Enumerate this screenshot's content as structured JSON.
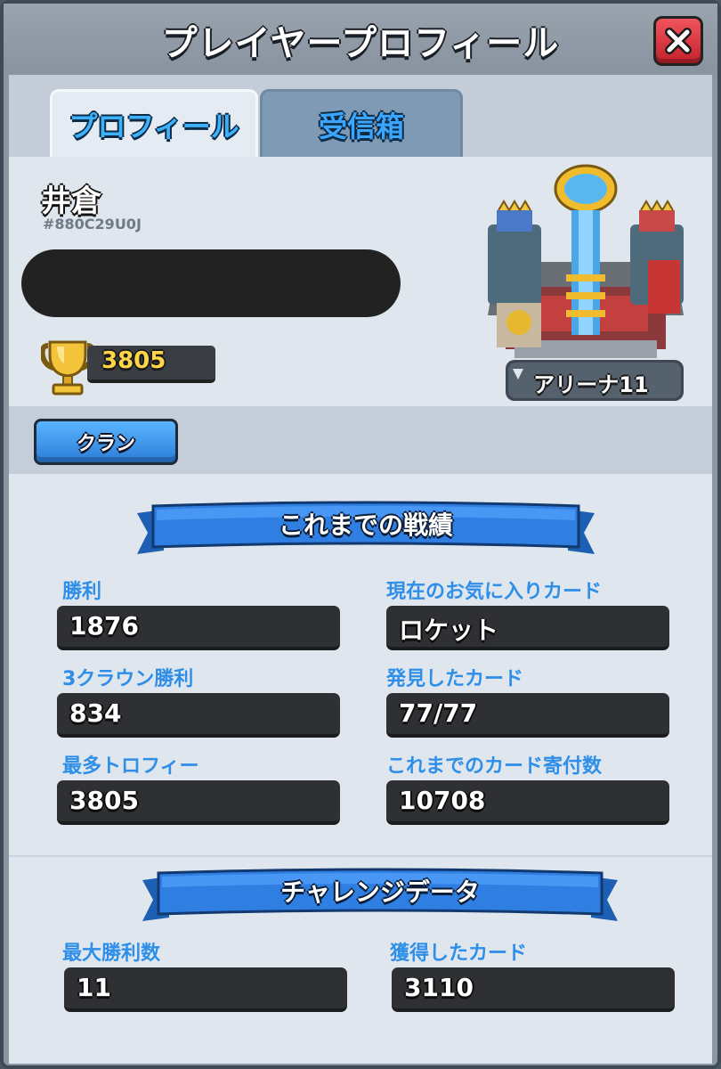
{
  "window": {
    "title": "プレイヤープロフィール",
    "close_icon": "close-x-icon"
  },
  "tabs": [
    {
      "label": "プロフィール",
      "active": true
    },
    {
      "label": "受信箱",
      "active": false
    }
  ],
  "player": {
    "name": "井倉",
    "tag": "#880C29U0J",
    "trophies": "3805",
    "arena_label": "アリーナ11",
    "clan_button": "クラン"
  },
  "career": {
    "header": "これまでの戦績",
    "stats": [
      {
        "label": "勝利",
        "value": "1876"
      },
      {
        "label": "現在のお気に入りカード",
        "value": "ロケット"
      },
      {
        "label": "3クラウン勝利",
        "value": "834"
      },
      {
        "label": "発見したカード",
        "value": "77/77"
      },
      {
        "label": "最多トロフィー",
        "value": "3805"
      },
      {
        "label": "これまでのカード寄付数",
        "value": "10708"
      }
    ]
  },
  "challenge": {
    "header": "チャレンジデータ",
    "stats": [
      {
        "label": "最大勝利数",
        "value": "11"
      },
      {
        "label": "獲得したカード",
        "value": "3110"
      }
    ]
  },
  "colors": {
    "accent_blue": "#2f8fe8",
    "close_red": "#e2353f",
    "trophy_gold": "#ffd54a"
  }
}
